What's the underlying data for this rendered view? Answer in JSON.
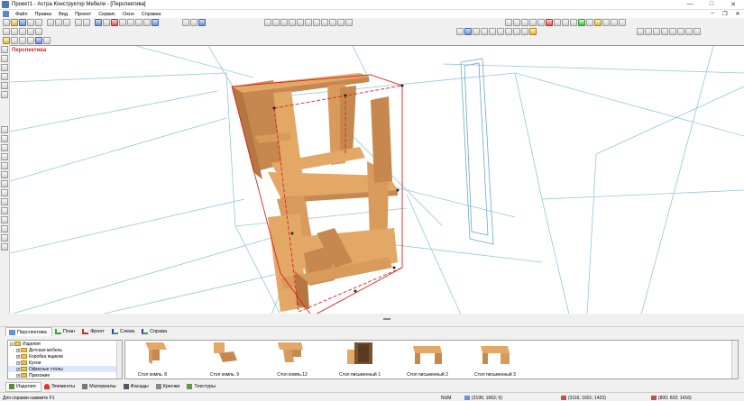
{
  "window": {
    "title": "Проект1 - Астра Конструктор Мебели - [Перспектива]"
  },
  "menu": [
    "Файл",
    "Правка",
    "Вид",
    "Проект",
    "Сервис",
    "Окно",
    "Справка"
  ],
  "viewport": {
    "label": "Перспектива"
  },
  "view_tabs": [
    {
      "label": "Перспектива",
      "active": true
    },
    {
      "label": "План",
      "active": false
    },
    {
      "label": "Фронт",
      "active": false
    },
    {
      "label": "Слева",
      "active": false
    },
    {
      "label": "Справа",
      "active": false
    }
  ],
  "tree": [
    {
      "label": "Изделия",
      "level": 0,
      "expand": "-"
    },
    {
      "label": "Детская мебель",
      "level": 1,
      "expand": "+"
    },
    {
      "label": "Коробка ящиков",
      "level": 1,
      "expand": "+"
    },
    {
      "label": "Кухни",
      "level": 1,
      "expand": "+"
    },
    {
      "label": "Офисные столы",
      "level": 1,
      "expand": "+"
    },
    {
      "label": "Прихожие",
      "level": 1,
      "expand": "+"
    }
  ],
  "gallery": [
    "Стол компь. 8",
    "Стол компь. 9",
    "Стол компь.12",
    "Стол письменный 1",
    "Стол письменный 2",
    "Стол письменный 3"
  ],
  "bottom_tabs": [
    {
      "label": "Изделия",
      "active": true
    },
    {
      "label": "Элементы",
      "active": false
    },
    {
      "label": "Материалы",
      "active": false
    },
    {
      "label": "Фасады",
      "active": false
    },
    {
      "label": "Крючки",
      "active": false
    },
    {
      "label": "Текстуры",
      "active": false
    }
  ],
  "status": {
    "help": "Для справки нажмите F1",
    "num": "NUM",
    "coord1": "(3196; 1663; 6)",
    "coord2": "(3116; 1601; 1422)",
    "coord3": "(800; 602; 1416)"
  },
  "colors": {
    "wood": "#e3a766",
    "wood_dark": "#c6884e",
    "grid": "#8fc9d6",
    "bbox": "#dd2222"
  }
}
